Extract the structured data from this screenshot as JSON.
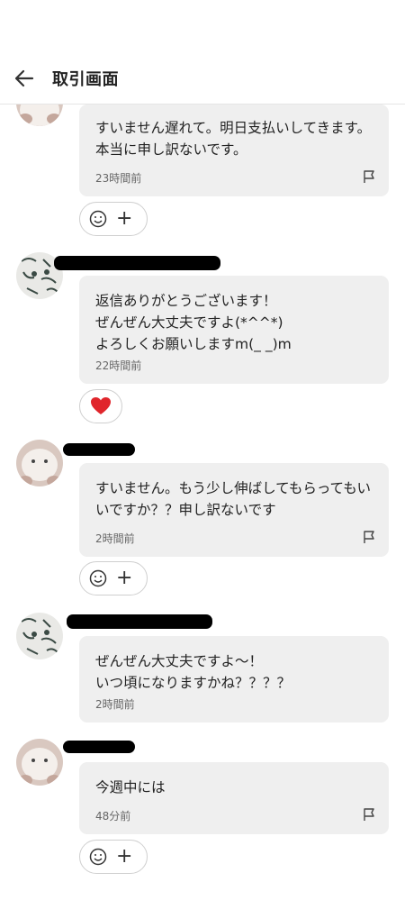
{
  "header": {
    "title": "取引画面",
    "back_icon": "arrow-left-icon"
  },
  "messages": [
    {
      "text": "すいません遅れて。明日支払いしてきます。本当に申し訳ないです。",
      "time": "23時間前",
      "reaction": "add",
      "sender": "cat"
    },
    {
      "text": "返信ありがとうございます！\nぜんぜん大丈夫ですよ(*^^*)\nよろしくお願いしますm(_ _)m",
      "time": "22時間前",
      "reaction": "heart",
      "sender": "drawing"
    },
    {
      "text": "すいません。もう少し伸ばしてもらってもいいですか？？申し訳ないです",
      "time": "2時間前",
      "reaction": "add",
      "sender": "cat"
    },
    {
      "text": "ぜんぜん大丈夫ですよ〜！\nいつ頃になりますかね？？？？",
      "time": "2時間前",
      "reaction": "none",
      "sender": "drawing"
    },
    {
      "text": "今週中には",
      "time": "48分前",
      "reaction": "add",
      "sender": "cat"
    }
  ],
  "colors": {
    "bubble": "#efefef",
    "heart": "#e0252b",
    "divider": "#e6e6e6"
  },
  "icons": {
    "flag": "flag-icon",
    "smile": "smile-icon",
    "plus": "plus-icon",
    "heart": "heart-icon"
  }
}
